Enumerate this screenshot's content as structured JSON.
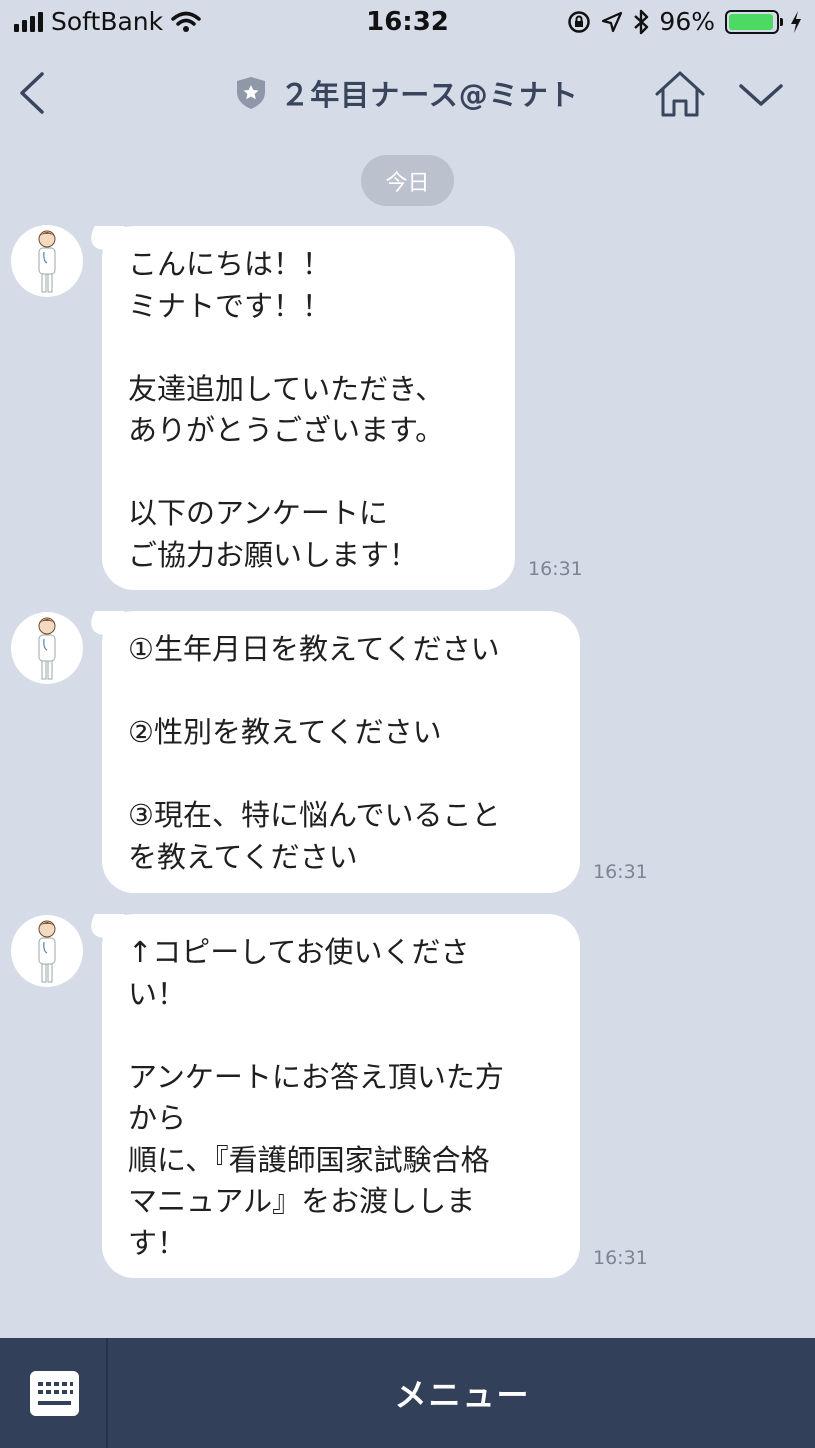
{
  "status_bar": {
    "carrier": "SoftBank",
    "time": "16:32",
    "battery_percent": "96%",
    "battery_level": 0.96
  },
  "header": {
    "title": "２年目ナース@ミナト",
    "back_icon": "chevron-left-icon",
    "badge_icon": "shield-star-icon",
    "home_icon": "home-icon",
    "dropdown_icon": "chevron-down-icon"
  },
  "date_label": "今日",
  "messages": [
    {
      "text": "こんにちは！！\nミナトです！！\n\n友達追加していただき、\nありがとうございます。\n\n以下のアンケートに\nご協力お願いします！",
      "time": "16:31"
    },
    {
      "text": "①生年月日を教えてください\n\n②性別を教えてください\n\n③現在、特に悩んでいること\nを教えてください",
      "time": "16:31"
    },
    {
      "text": "↑コピーしてお使いくださ\nい！\n\nアンケートにお答え頂いた方\nから\n順に、『看護師国家試験合格\nマニュアル』をお渡ししま\nす！",
      "time": "16:31"
    }
  ],
  "bottom_bar": {
    "keyboard_icon": "keyboard-icon",
    "menu_label": "メニュー"
  },
  "colors": {
    "background": "#d5dbe7",
    "header_text": "#38455c",
    "bottom_bar": "#334059",
    "battery": "#4cd964"
  }
}
